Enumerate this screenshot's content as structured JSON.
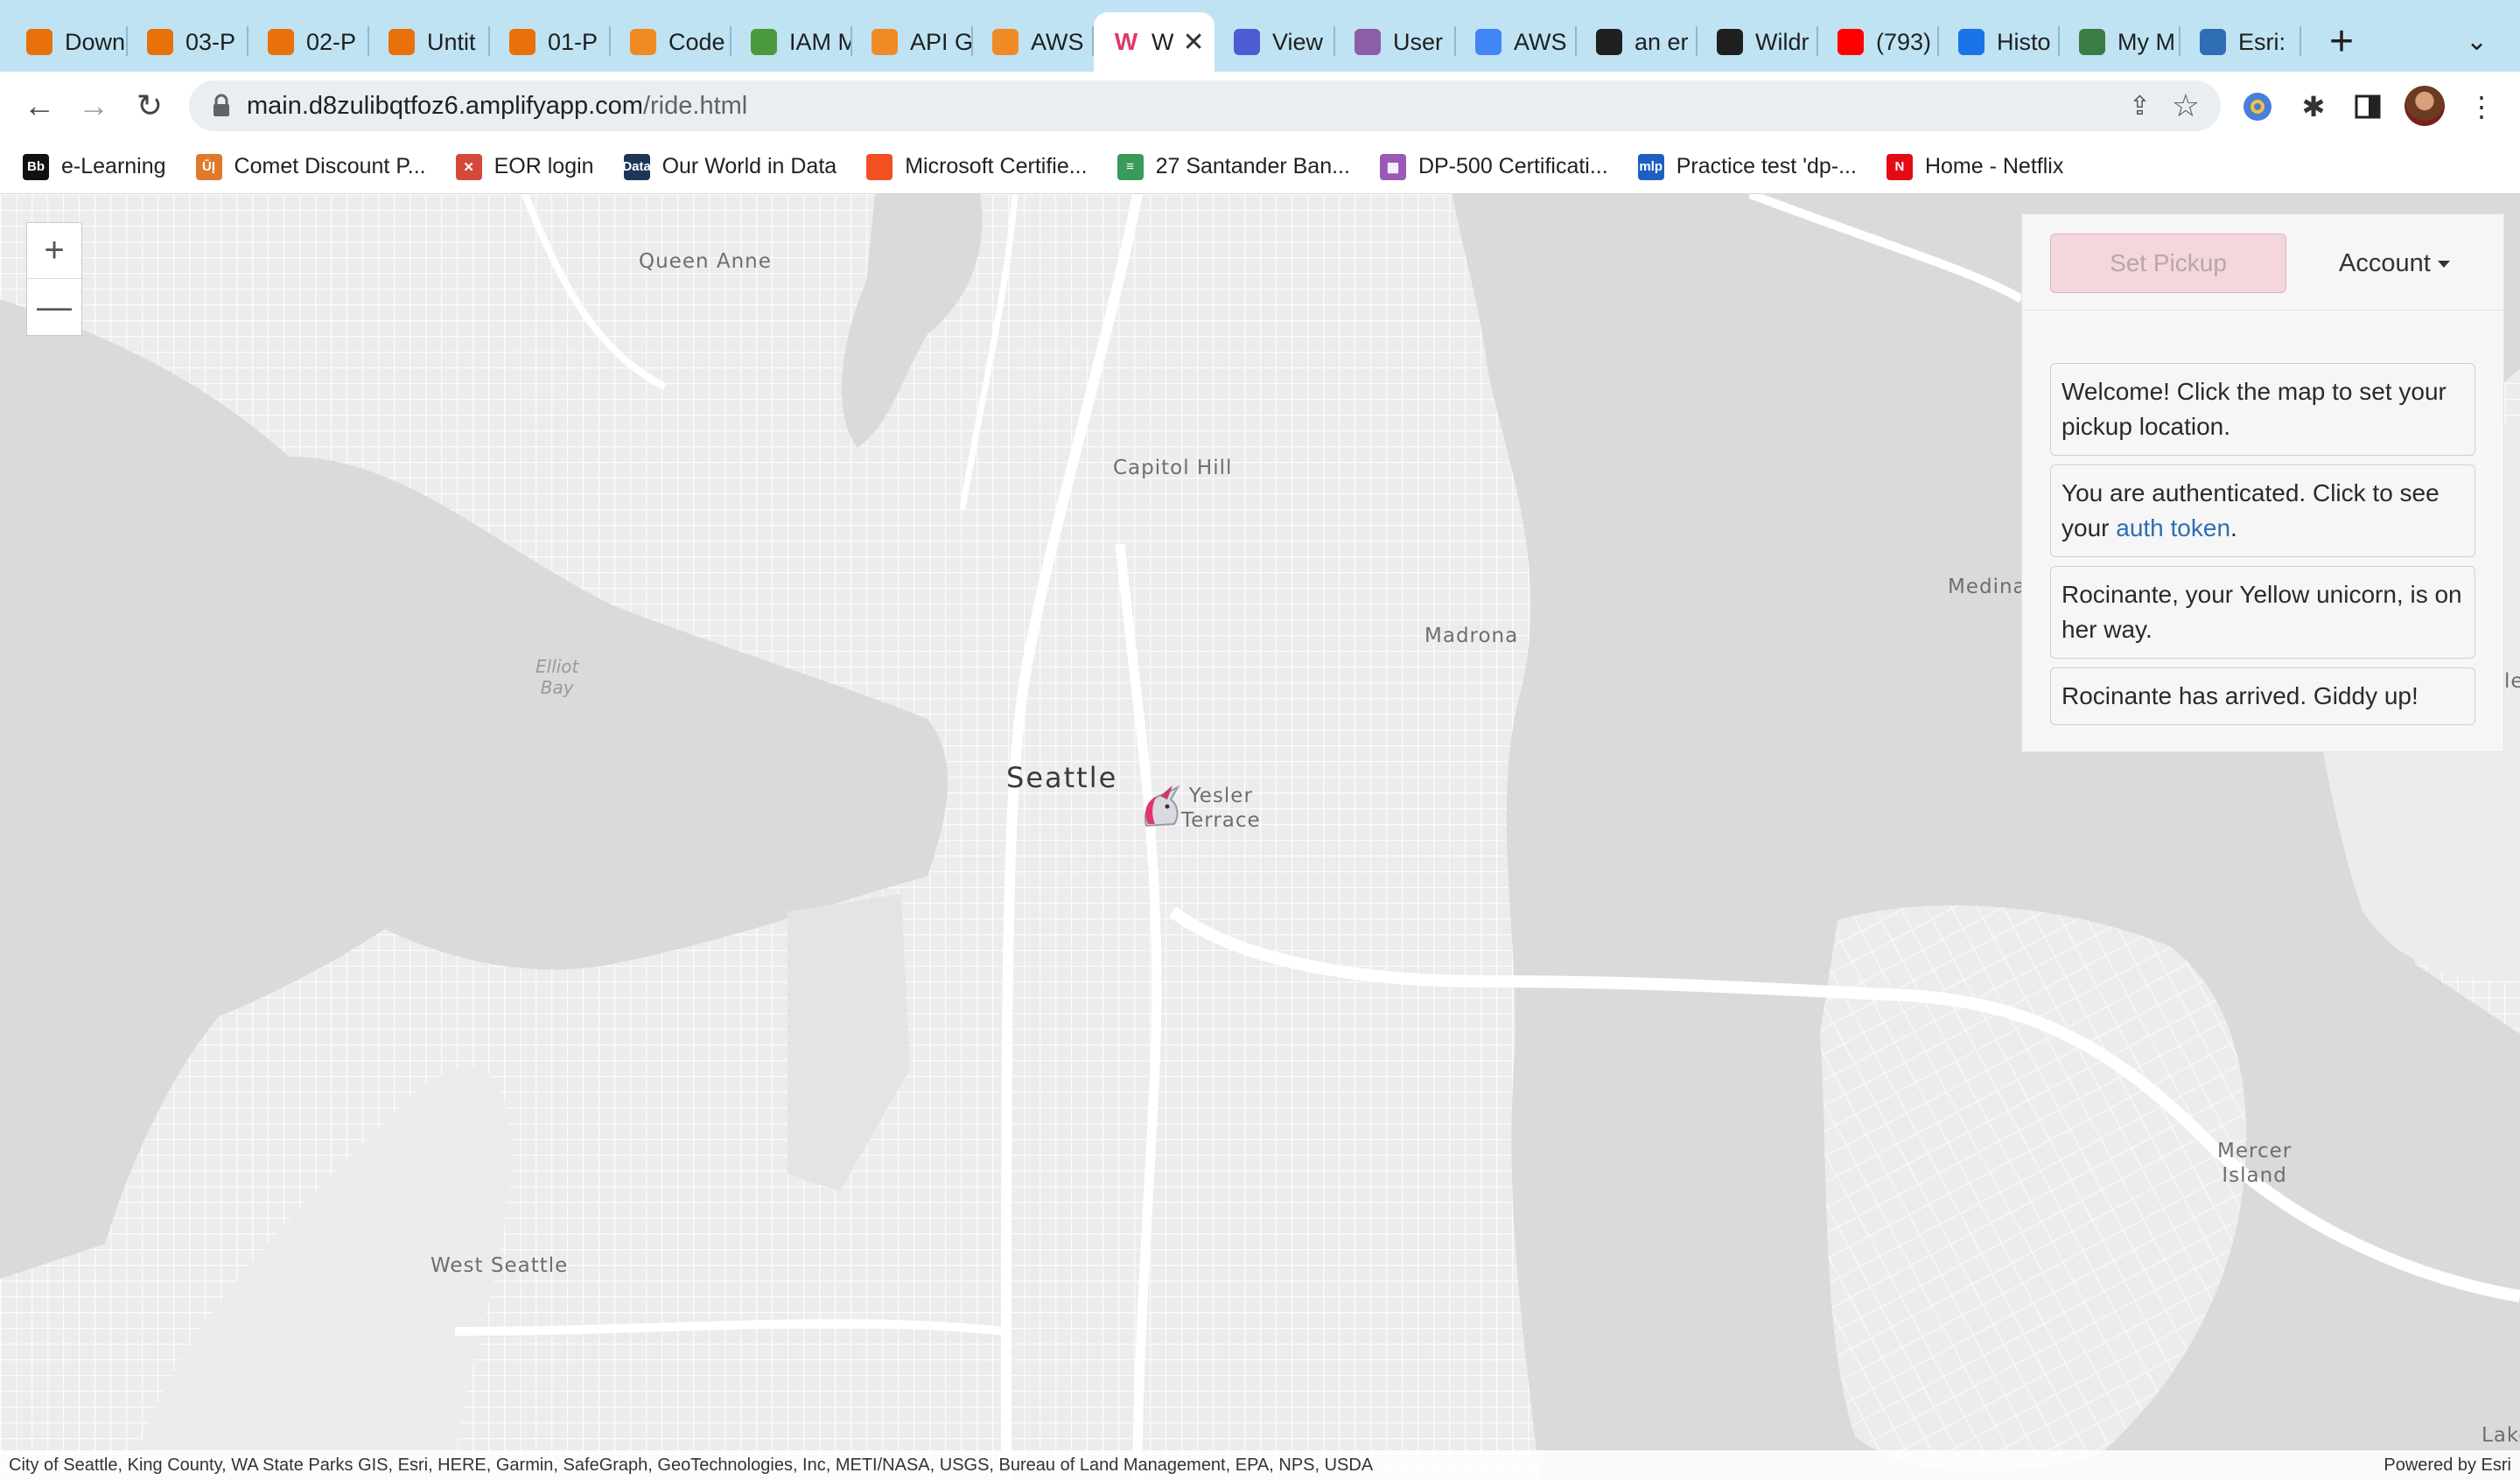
{
  "browser": {
    "tabs": [
      {
        "title": "Down",
        "icon": "loading-icon",
        "color": "#e8710a"
      },
      {
        "title": "03-P",
        "icon": "book-icon",
        "color": "#e8710a"
      },
      {
        "title": "02-P",
        "icon": "book-icon",
        "color": "#e8710a"
      },
      {
        "title": "Untit",
        "icon": "book-icon",
        "color": "#e8710a"
      },
      {
        "title": "01-P",
        "icon": "book-icon",
        "color": "#e8710a"
      },
      {
        "title": "Code",
        "icon": "aws-box-icon",
        "color": "#f08a24"
      },
      {
        "title": "IAM M",
        "icon": "iam-key-icon",
        "color": "#4a9a3d"
      },
      {
        "title": "API G",
        "icon": "aws-box-icon",
        "color": "#f08a24"
      },
      {
        "title": "AWS",
        "icon": "aws-box-icon",
        "color": "#f08a24"
      },
      {
        "title": "W",
        "icon": "wildrydes-icon",
        "color": "#e2366b",
        "active": true
      },
      {
        "title": "View",
        "icon": "cognito-icon",
        "color": "#4f5bd5"
      },
      {
        "title": "User",
        "icon": "cognito-hex-icon",
        "color": "#8b5ea8"
      },
      {
        "title": "AWS",
        "icon": "google-icon",
        "color": "#4285f4"
      },
      {
        "title": "an er",
        "icon": "github-icon",
        "color": "#1f1f1f"
      },
      {
        "title": "Wildr",
        "icon": "github-icon",
        "color": "#1f1f1f"
      },
      {
        "title": "(793)",
        "icon": "youtube-icon",
        "color": "#ff0000"
      },
      {
        "title": "Histo",
        "icon": "history-icon",
        "color": "#1a73e8"
      },
      {
        "title": "My M",
        "icon": "globe-icon",
        "color": "#3a7d44"
      },
      {
        "title": "Esri:",
        "icon": "esri-icon",
        "color": "#2f6db5"
      }
    ],
    "active_close": "✕",
    "new_tab": "+",
    "url_host": "main.d8zulibqtfoz6.amplifyapp.com",
    "url_path": "/ride.html",
    "bookmarks": [
      {
        "label": "e-Learning",
        "icon": "blackboard-icon",
        "badge": "Bb",
        "color": "#111111"
      },
      {
        "label": "Comet Discount P...",
        "icon": "comet-icon",
        "badge": "ŪĮ",
        "color": "#e07a2a"
      },
      {
        "label": "EOR login",
        "icon": "eor-icon",
        "badge": "✕",
        "color": "#d44a3a"
      },
      {
        "label": "Our World in Data",
        "icon": "owid-icon",
        "badge": "Data",
        "color": "#1d3557"
      },
      {
        "label": "Microsoft Certifie...",
        "icon": "microsoft-icon",
        "badge": "",
        "color": "#f25022"
      },
      {
        "label": "27 Santander Ban...",
        "icon": "santander-icon",
        "badge": "≡",
        "color": "#3a9a5a"
      },
      {
        "label": "DP-500 Certificati...",
        "icon": "dp500-icon",
        "badge": "▦",
        "color": "#9b59b6"
      },
      {
        "label": "Practice test 'dp-...",
        "icon": "mlp-icon",
        "badge": "mlp",
        "color": "#1f5fbf"
      },
      {
        "label": "Home - Netflix",
        "icon": "netflix-icon",
        "badge": "N",
        "color": "#e50914"
      }
    ]
  },
  "map": {
    "places": {
      "queen_anne": "Queen Anne",
      "capitol_hill": "Capitol Hill",
      "madrona": "Madrona",
      "medina": "Medina",
      "seattle": "Seattle",
      "yesler_terrace": "Yesler\nTerrace",
      "west_seattle": "West Seattle",
      "mercer_island": "Mercer\nIsland",
      "elliott_bay": "Elliot\nBay",
      "edge_le": "le",
      "edge_lake": "Lake"
    },
    "zoom_in": "+",
    "zoom_out": "—",
    "attribution": "City of Seattle, King County, WA State Parks GIS, Esri, HERE, Garmin, SafeGraph, GeoTechnologies, Inc, METI/NASA, USGS, Bureau of Land Management, EPA, NPS, USDA",
    "powered_by": "Powered by Esri"
  },
  "panel": {
    "set_pickup": "Set Pickup",
    "account": "Account",
    "messages": {
      "welcome": "Welcome! Click the map to set your pickup location.",
      "auth_prefix": "You are authenticated. Click to see your ",
      "auth_link": "auth token",
      "auth_suffix": ".",
      "on_way": "Rocinante, your Yellow unicorn, is on her way.",
      "arrived": "Rocinante has arrived. Giddy up!"
    }
  },
  "colors": {
    "tabstrip": "#bfe3f3",
    "water": "#dcdcdc",
    "land": "#ececec",
    "pickup_button": "#f4d6dd",
    "link": "#2f6db5"
  }
}
